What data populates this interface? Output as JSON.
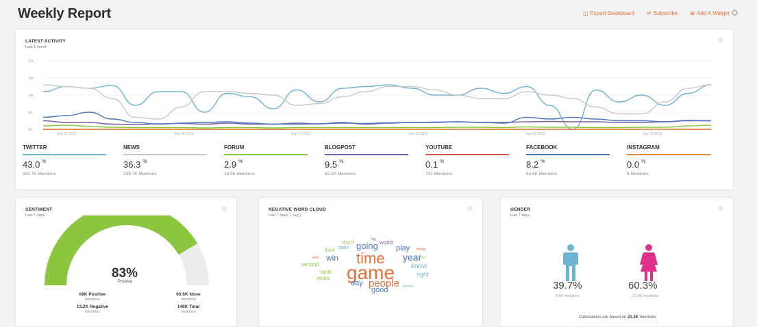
{
  "header": {
    "title": "Weekly Report",
    "actions": [
      {
        "label": "Export Dashboard",
        "icon": "export-icon"
      },
      {
        "label": "Subscribe",
        "icon": "envelope-icon"
      },
      {
        "label": "Add A Widget",
        "icon": "plus-box-icon"
      }
    ]
  },
  "activity": {
    "title": "LATEST ACTIVITY",
    "subtitle": "Last 1 month",
    "y_ticks": [
      "20k",
      "15k",
      "10k",
      "5k",
      "0k"
    ],
    "x_ticks": [
      "Sep 01 2013",
      "Sep 06 2013",
      "Sep 11 2013",
      "Sep 16 2013",
      "Sep 21 2013",
      "Sep 26 2013"
    ],
    "colors": {
      "twitter": "#6fb3d2",
      "news": "#c8c8c8",
      "forum": "#8cc63e",
      "blogpost": "#7b5aa6",
      "youtube": "#d9534f",
      "facebook": "#4a78c2",
      "instagram": "#e08a3c"
    },
    "stats": [
      {
        "name": "TWITTER",
        "value": "43.0",
        "unit": "%",
        "mentions": "282.7K Mentions"
      },
      {
        "name": "NEWS",
        "value": "36.3",
        "unit": "%",
        "mentions": "238.7K Mentions"
      },
      {
        "name": "FORUM",
        "value": "2.9",
        "unit": "%",
        "mentions": "18.9K Mentions"
      },
      {
        "name": "BLOGPOST",
        "value": "9.5",
        "unit": "%",
        "mentions": "62.1K Mentions"
      },
      {
        "name": "YOUTUBE",
        "value": "0.1",
        "unit": "%",
        "mentions": "741 Mentions"
      },
      {
        "name": "FACEBOOK",
        "value": "8.2",
        "unit": "%",
        "mentions": "53.6K Mentions"
      },
      {
        "name": "INSTAGRAM",
        "value": "0.0",
        "unit": "%",
        "mentions": "8 Mentions"
      }
    ]
  },
  "sentiment": {
    "title": "SENTIMENT",
    "subtitle": "Last 7 days",
    "percent": "83%",
    "percent_value": 0.83,
    "percent_label": "Positive",
    "positive": "69K Positive",
    "positive_sub": "mentions",
    "negative": "13.2K Negative",
    "negative_sub": "mentions",
    "none": "60.6K None",
    "none_sub": "mentions",
    "total": "148K Total",
    "total_sub": "mentions",
    "colors": {
      "positive": "#8cc63e",
      "rest": "#ececec"
    }
  },
  "wordcloud": {
    "title": "NEGATIVE WORD CLOUD",
    "subtitle": "Last 7 days, ( neg )",
    "words": [
      {
        "text": "game",
        "color": "#e4703a"
      },
      {
        "text": "time",
        "color": "#e4703a"
      },
      {
        "text": "people",
        "color": "#e4703a"
      },
      {
        "text": "going",
        "color": "#4a78c2"
      },
      {
        "text": "year",
        "color": "#4a78c2"
      },
      {
        "text": "play",
        "color": "#4a78c2"
      },
      {
        "text": "win",
        "color": "#4a78c2"
      },
      {
        "text": "good",
        "color": "#4a78c2"
      },
      {
        "text": "day",
        "color": "#4a78c2"
      },
      {
        "text": "know",
        "color": "#6fb3d2"
      },
      {
        "text": "right",
        "color": "#6fb3d2"
      },
      {
        "text": "second",
        "color": "#8cc63e"
      },
      {
        "text": "land",
        "color": "#8cc63e"
      },
      {
        "text": "years",
        "color": "#8cc63e"
      },
      {
        "text": "don't",
        "color": "#8cc63e"
      },
      {
        "text": "think",
        "color": "#8cc63e"
      },
      {
        "text": "team",
        "color": "#6fb3d2"
      },
      {
        "text": "world",
        "color": "#7b5aa6"
      },
      {
        "text": "toronto",
        "color": "#6fb3d2"
      },
      {
        "text": "old",
        "color": "#8cc63e"
      },
      {
        "text": "ever",
        "color": "#e4703a"
      },
      {
        "text": "big",
        "color": "#7b5aa6"
      },
      {
        "text": "things",
        "color": "#e4703a"
      }
    ]
  },
  "gender": {
    "title": "GENDER",
    "subtitle": "Last 7 days",
    "male_pct": "39.7%",
    "male_sub": "8.5K mentions",
    "female_pct": "60.3%",
    "female_sub": "12.9K mentions",
    "calc_prefix": "Calculations are based on",
    "calc_value": "21.3K",
    "calc_suffix": "mentions",
    "colors": {
      "male": "#6fb3d2",
      "female": "#e0318a"
    }
  },
  "chart_data": {
    "type": "line",
    "x": [
      "Sep 01",
      "Sep 02",
      "Sep 03",
      "Sep 04",
      "Sep 05",
      "Sep 06",
      "Sep 07",
      "Sep 08",
      "Sep 09",
      "Sep 10",
      "Sep 11",
      "Sep 12",
      "Sep 13",
      "Sep 14",
      "Sep 15",
      "Sep 16",
      "Sep 17",
      "Sep 18",
      "Sep 19",
      "Sep 20",
      "Sep 21",
      "Sep 22",
      "Sep 23",
      "Sep 24",
      "Sep 25",
      "Sep 26",
      "Sep 27",
      "Sep 28",
      "Sep 29",
      "Sep 30"
    ],
    "ylim": [
      0,
      20000
    ],
    "series": [
      {
        "name": "TWITTER",
        "values": [
          11000,
          12500,
          12000,
          12800,
          7000,
          11000,
          11000,
          5000,
          10500,
          9500,
          6000,
          11500,
          8000,
          12000,
          12500,
          13000,
          12000,
          10000,
          10000,
          12000,
          10500,
          12500,
          7000,
          0,
          11500,
          8000,
          10000,
          7000,
          10500,
          13000
        ]
      },
      {
        "name": "NEWS",
        "values": [
          13000,
          12500,
          12000,
          9000,
          3500,
          3000,
          6500,
          11000,
          11000,
          10500,
          10000,
          7000,
          7500,
          9500,
          11000,
          12500,
          12500,
          11500,
          10000,
          9000,
          9000,
          11000,
          10000,
          9000,
          6500,
          4500,
          4500,
          8000,
          12000,
          13000
        ]
      },
      {
        "name": "BLOGPOST",
        "values": [
          2500,
          2000,
          2000,
          1500,
          1400,
          1600,
          1700,
          1500,
          1800,
          1500,
          1500,
          1800,
          1600,
          2000,
          1500,
          1800,
          2000,
          2000,
          2200,
          2000,
          2000,
          2200,
          2300,
          2200,
          2200,
          2000,
          2000,
          2200,
          2500,
          2500
        ]
      },
      {
        "name": "FACEBOOK",
        "values": [
          3500,
          4000,
          5000,
          3000,
          2000,
          1500,
          1800,
          2000,
          2200,
          1800,
          1500,
          1500,
          1600,
          1800,
          1700,
          1900,
          2000,
          2100,
          2200,
          2000,
          1800,
          3500,
          3000,
          3500,
          3000,
          2500,
          2500,
          2200,
          2600,
          2500
        ]
      },
      {
        "name": "FORUM",
        "values": [
          1000,
          1200,
          900,
          600,
          500,
          500,
          500,
          400,
          500,
          500,
          400,
          500,
          500,
          500,
          500,
          500,
          500,
          500,
          600,
          600,
          500,
          700,
          600,
          600,
          500,
          500,
          600,
          600,
          1000,
          1200
        ]
      },
      {
        "name": "YOUTUBE",
        "values": [
          0,
          0,
          0,
          0,
          0,
          0,
          0,
          0,
          0,
          0,
          0,
          0,
          0,
          0,
          0,
          0,
          0,
          0,
          0,
          0,
          0,
          0,
          0,
          0,
          0,
          0,
          0,
          0,
          0,
          0
        ]
      },
      {
        "name": "INSTAGRAM",
        "values": [
          0,
          0,
          0,
          0,
          0,
          0,
          0,
          0,
          0,
          0,
          0,
          0,
          0,
          0,
          0,
          0,
          0,
          0,
          0,
          0,
          0,
          0,
          0,
          0,
          0,
          0,
          0,
          0,
          0,
          0
        ]
      }
    ],
    "y_ticks": [
      "20k",
      "15k",
      "10k",
      "5k",
      "0k"
    ],
    "x_ticks": [
      "Sep 01 2013",
      "Sep 06 2013",
      "Sep 11 2013",
      "Sep 16 2013",
      "Sep 21 2013",
      "Sep 26 2013"
    ]
  }
}
